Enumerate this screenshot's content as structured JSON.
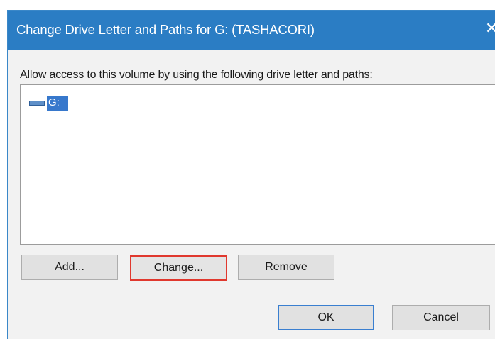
{
  "dialog": {
    "title": "Change Drive Letter and Paths for G: (TASHACORI)",
    "close_glyph": "✕",
    "instruction": "Allow access to this volume by using the following drive letter and paths:",
    "items": [
      {
        "label": "G:",
        "icon": "drive-icon",
        "selected": true
      }
    ],
    "buttons": {
      "add": "Add...",
      "change": "Change...",
      "remove": "Remove",
      "ok": "OK",
      "cancel": "Cancel"
    },
    "colors": {
      "titlebar": "#2b7dc4",
      "selection": "#3778cc",
      "highlight_border": "#e0382e"
    }
  }
}
